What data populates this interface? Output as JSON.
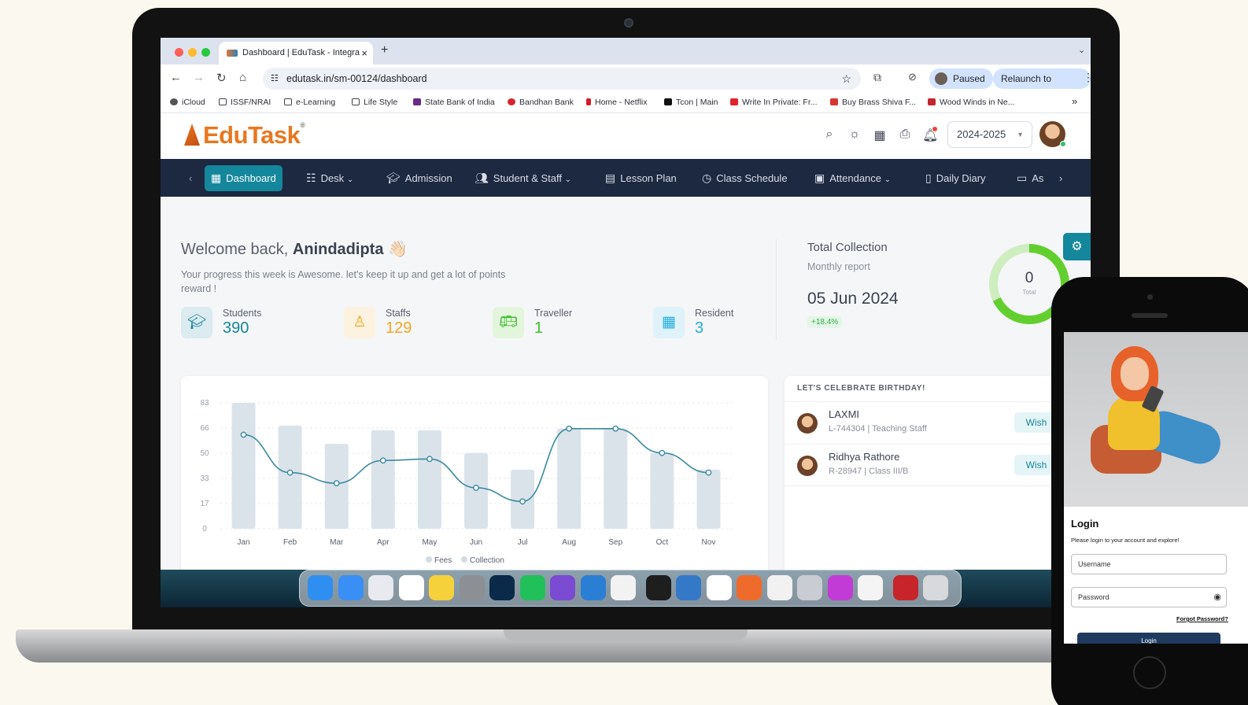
{
  "browser": {
    "tab_title": "Dashboard | EduTask - Integra",
    "url": "edutask.in/sm-00124/dashboard",
    "paused_label": "Paused",
    "relaunch_label": "Relaunch to update",
    "bookmarks": [
      "iCloud",
      "ISSF/NRAI",
      "e-Learning",
      "Life Style",
      "State Bank of India",
      "Bandhan Bank",
      "Home - Netflix",
      "Tcon | Main",
      "Write In Private: Fr...",
      "Buy Brass Shiva F...",
      "Wood Winds in Ne..."
    ]
  },
  "app": {
    "logo": "EduTask",
    "year": "2024-2025",
    "nav": [
      "Dashboard",
      "Desk",
      "Admission",
      "Student & Staff",
      "Lesson Plan",
      "Class Schedule",
      "Attendance",
      "Daily Diary",
      "As"
    ],
    "welcome_prefix": "Welcome back, ",
    "welcome_name": "Anindadipta",
    "welcome_emoji": "👋🏻",
    "welcome_sub": "Your progress this week is Awesome. let's keep it up and get a lot of points reward !",
    "stats": [
      {
        "label": "Students",
        "value": "390",
        "color": "#14879c",
        "icon": "graduate-icon"
      },
      {
        "label": "Staffs",
        "value": "129",
        "color": "#f4a51d",
        "icon": "teacher-icon"
      },
      {
        "label": "Traveller",
        "value": "1",
        "color": "#3fbf2f",
        "icon": "bus-icon"
      },
      {
        "label": "Resident",
        "value": "3",
        "color": "#21aee0",
        "icon": "building-icon"
      }
    ],
    "total_collection": {
      "title": "Total Collection",
      "subtitle": "Monthly report",
      "date": "05 Jun 2024",
      "badge": "+18.4%",
      "ring_value": "0",
      "ring_label": "Total"
    },
    "birthday": {
      "title": "LET'S CELEBRATE BIRTHDAY!",
      "rows": [
        {
          "name": "LAXMI",
          "detail": "L-744304 | Teaching Staff",
          "action": "Wish"
        },
        {
          "name": "Ridhya Rathore",
          "detail": "R-28947 | Class III/B",
          "action": "Wish"
        }
      ]
    }
  },
  "chart_data": {
    "type": "bar",
    "categories": [
      "Jan",
      "Feb",
      "Mar",
      "Apr",
      "May",
      "Jun",
      "Jul",
      "Aug",
      "Sep",
      "Oct",
      "Nov"
    ],
    "yticks": [
      "0",
      "17",
      "33",
      "50",
      "66",
      "83"
    ],
    "ylim": [
      0,
      83
    ],
    "series": [
      {
        "name": "Fees",
        "type": "bar",
        "values": [
          83,
          68,
          56,
          65,
          65,
          50,
          39,
          66,
          66,
          50,
          39
        ]
      },
      {
        "name": "Collection",
        "type": "line",
        "values": [
          62,
          37,
          30,
          45,
          46,
          27,
          18,
          66,
          66,
          50,
          37
        ]
      }
    ],
    "legend": "bottom",
    "grid": true,
    "colors": {
      "bar": "#dbe3ea",
      "line": "#3a8a9f"
    }
  },
  "phone": {
    "title": "Login",
    "subtitle": "Please login to your account and explore!",
    "username_placeholder": "Username",
    "password_placeholder": "Password",
    "forgot": "Forgot Password?",
    "button": "Login"
  },
  "dock_apps": [
    "finder-icon",
    "mail-icon",
    "outlook-icon",
    "calendar-icon",
    "notes-icon",
    "settings-icon",
    "photoshop-icon",
    "whatsapp-icon",
    "github-icon",
    "vscode-icon",
    "chrome-icon",
    "figma-icon",
    "app-r-icon",
    "slack-icon",
    "pen-icon",
    "textedit-icon",
    "preferences-icon",
    "wps-icon",
    "bear-icon",
    "acrobat-icon",
    "trash-icon"
  ]
}
